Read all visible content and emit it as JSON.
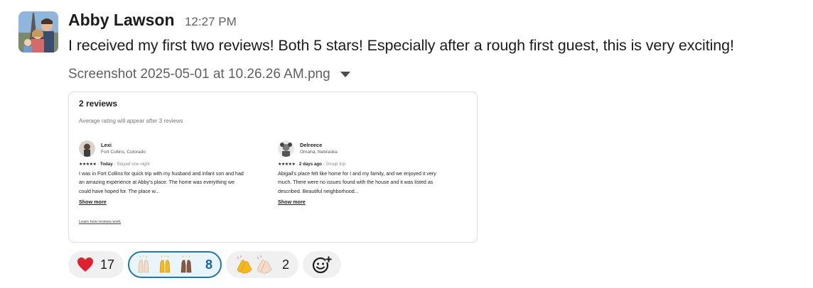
{
  "message": {
    "author": "Abby Lawson",
    "time": "12:27 PM",
    "text": "I received my first two reviews! Both 5 stars! Especially after a rough first guest, this is very exciting!",
    "attachment_name": "Screenshot 2025-05-01 at 10.26.26 AM.png"
  },
  "screenshot": {
    "title": "2 reviews",
    "subtitle": "Average rating will appear after 3 reviews",
    "reviews": [
      {
        "name": "Lexi",
        "location": "Fort Collins, Colorado",
        "stars": "★★★★★",
        "when": "Today",
        "trip": "Stayed one night",
        "text": "I was in Fort Collins for quick trip with my husband and infant son and had an amazing experience at Abby's place. The home was everything we could have hoped for. The place w...",
        "show_more": "Show more",
        "rating": 5
      },
      {
        "name": "Delreece",
        "location": "Omaha, Nebraska",
        "stars": "★★★★★",
        "when": "2 days ago",
        "trip": "Group trip",
        "text": "Abigail's place felt like home for I and my family, and we enjoyed it very much. There were no issues found with the house and it was listed as described. Beautiful neighborhood...",
        "show_more": "Show more",
        "rating": 5
      }
    ],
    "learn_link": "Learn how reviews work"
  },
  "reactions": [
    {
      "emoji": "heart",
      "count": "17",
      "selected": false
    },
    {
      "emoji": "raised-hands-skin-tones",
      "count": "8",
      "selected": true
    },
    {
      "emoji": "clapping-hands-skin-tones",
      "count": "2",
      "selected": false
    },
    {
      "emoji": "add-reaction-icon",
      "count": "",
      "selected": false
    }
  ],
  "colors": {
    "selected_border": "#1d78a8",
    "selected_count": "#1264a3",
    "pill_bg": "#f0f0f0"
  }
}
